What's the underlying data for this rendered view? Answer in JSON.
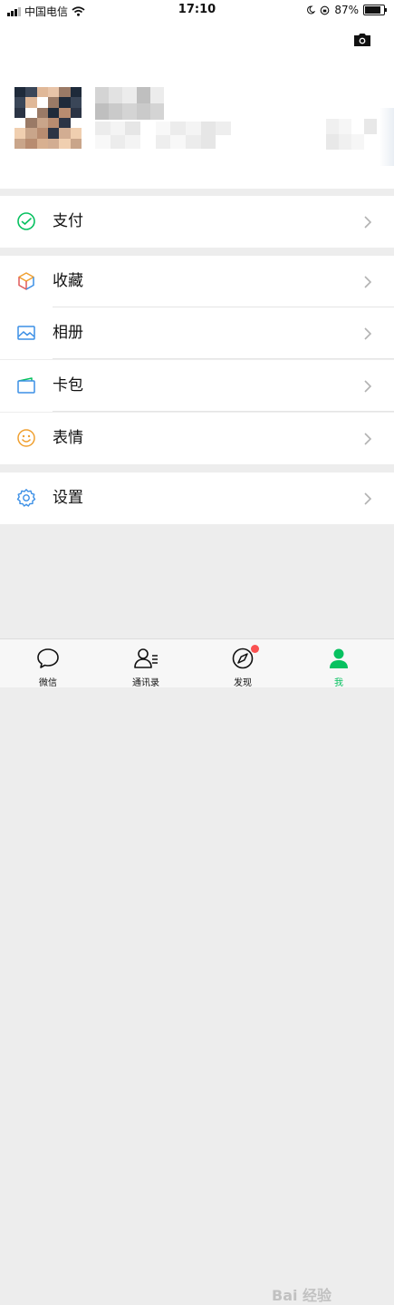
{
  "status_bar": {
    "carrier": "中国电信",
    "time": "17:10",
    "battery": "87%",
    "battery_level": 0.87
  },
  "menu": {
    "pay": "支付",
    "favorites": "收藏",
    "album": "相册",
    "cards": "卡包",
    "stickers": "表情",
    "settings": "设置"
  },
  "tabs": {
    "chats": "微信",
    "contacts": "通讯录",
    "discover": "发现",
    "me": "我",
    "active": "me"
  },
  "watermark": "Bai 经验",
  "colors": {
    "accent": "#07c160",
    "badge": "#fa5151",
    "pay_icon": "#07c160",
    "favorites_icon": "#f0a030",
    "album_icon": "#3b8fe6",
    "cards_icon": "#3b8fe6",
    "stickers_icon": "#f0a030",
    "settings_icon": "#3b8fe6"
  },
  "icons": {
    "camera": "camera-icon",
    "pay": "pay-check-icon",
    "favorites": "cube-icon",
    "album": "picture-icon",
    "cards": "wallet-card-icon",
    "stickers": "smiley-icon",
    "settings": "gear-icon",
    "chevron": "chevron-right-icon"
  }
}
